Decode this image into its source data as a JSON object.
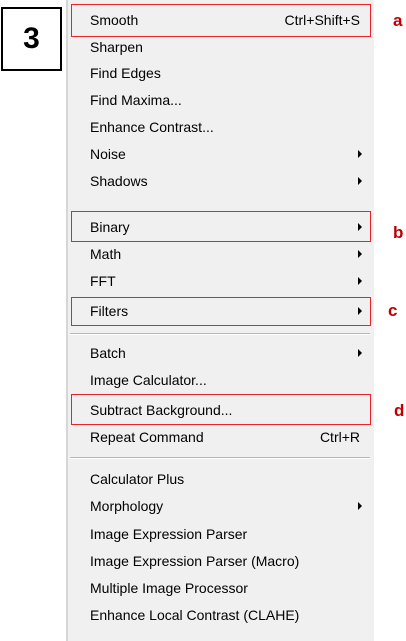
{
  "step_number": "3",
  "menu": {
    "items": [
      {
        "label": "Smooth",
        "shortcut": "Ctrl+Shift+S",
        "submenu": false
      },
      {
        "label": "Sharpen",
        "shortcut": "",
        "submenu": false
      },
      {
        "label": "Find Edges",
        "shortcut": "",
        "submenu": false
      },
      {
        "label": "Find Maxima...",
        "shortcut": "",
        "submenu": false
      },
      {
        "label": "Enhance Contrast...",
        "shortcut": "",
        "submenu": false
      },
      {
        "label": "Noise",
        "shortcut": "",
        "submenu": true
      },
      {
        "label": "Shadows",
        "shortcut": "",
        "submenu": true
      },
      {
        "label": "Binary",
        "shortcut": "",
        "submenu": true
      },
      {
        "label": "Math",
        "shortcut": "",
        "submenu": true
      },
      {
        "label": "FFT",
        "shortcut": "",
        "submenu": true
      },
      {
        "label": "Filters",
        "shortcut": "",
        "submenu": true
      },
      {
        "label": "Batch",
        "shortcut": "",
        "submenu": true
      },
      {
        "label": "Image Calculator...",
        "shortcut": "",
        "submenu": false
      },
      {
        "label": "Subtract Background...",
        "shortcut": "",
        "submenu": false
      },
      {
        "label": "Repeat Command",
        "shortcut": "Ctrl+R",
        "submenu": false
      },
      {
        "label": "Calculator Plus",
        "shortcut": "",
        "submenu": false
      },
      {
        "label": "Morphology",
        "shortcut": "",
        "submenu": true
      },
      {
        "label": "Image Expression Parser",
        "shortcut": "",
        "submenu": false
      },
      {
        "label": "Image Expression Parser (Macro)",
        "shortcut": "",
        "submenu": false
      },
      {
        "label": "Multiple Image Processor",
        "shortcut": "",
        "submenu": false
      },
      {
        "label": "Enhance Local Contrast (CLAHE)",
        "shortcut": "",
        "submenu": false
      }
    ]
  },
  "annotations": {
    "a": "a",
    "b": "b",
    "c": "c",
    "d": "d"
  },
  "colors": {
    "menu_background": "#f0f0f0",
    "highlight_border": "#e8232a",
    "annotation_text": "#c00000"
  }
}
